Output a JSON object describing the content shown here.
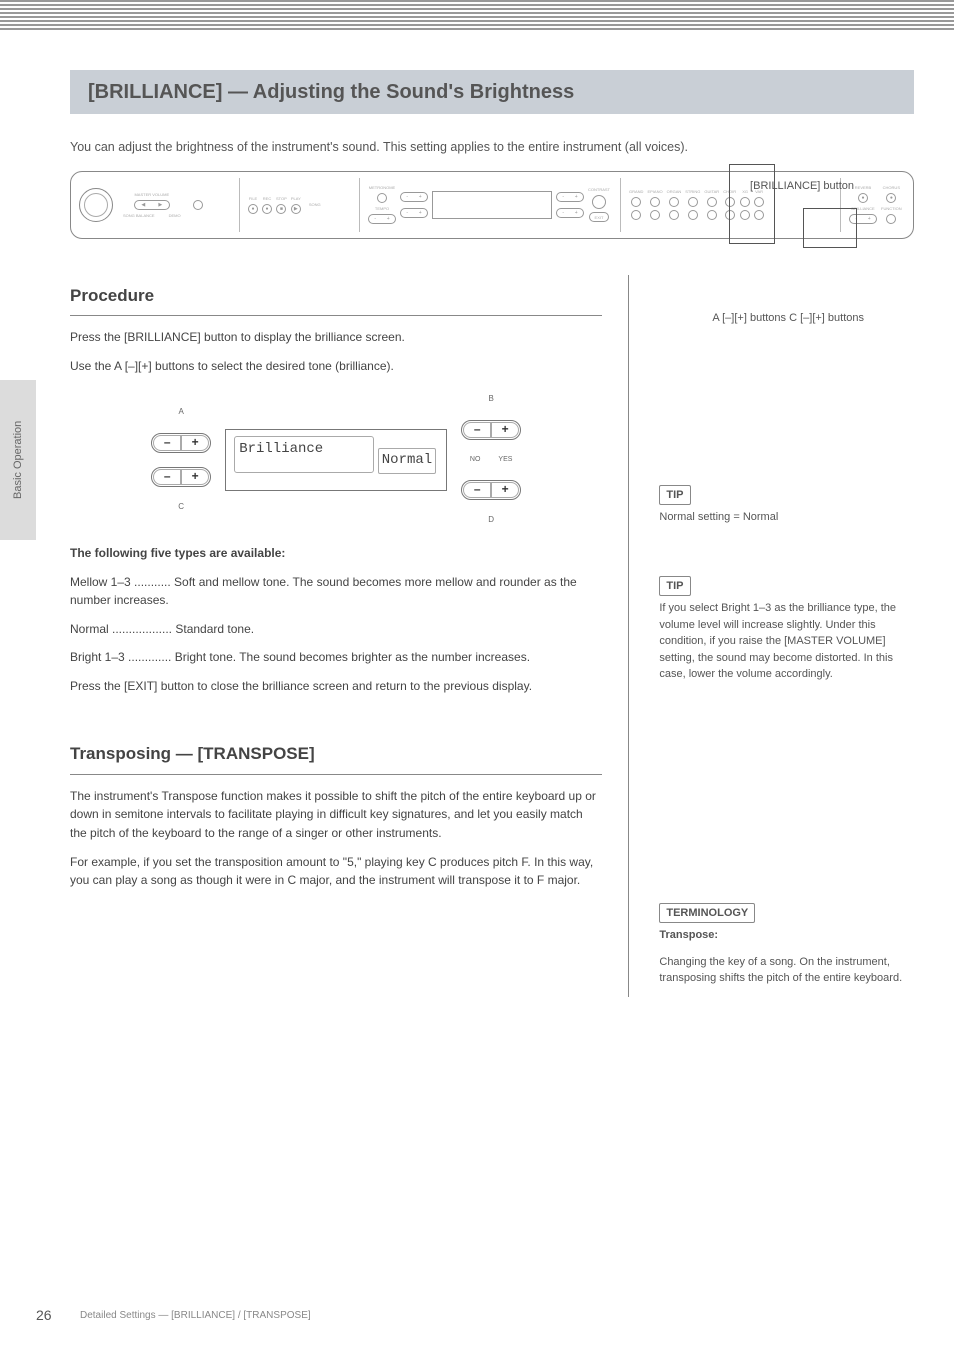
{
  "header": {
    "title": "[BRILLIANCE] — Adjusting the Sound's Brightness"
  },
  "intro": "You can adjust the brightness of the instrument's sound. This setting applies to the entire instrument (all voices).",
  "equipment_labels": {
    "left_label": "MASTER VOLUME",
    "left_sub1": "SONG BALANCE",
    "left_sub2": "DEMO",
    "song_title": "SONG",
    "metronome": "METRONOME",
    "tempo": "TEMPO",
    "contrast": "CONTRAST",
    "exit": "EXIT",
    "voice_title": "VOICE",
    "reverb": "REVERB",
    "chorus": "CHORUS",
    "func": "FUNCTION"
  },
  "callouts": {
    "buttons": "[BRILLIANCE] button",
    "abcd": "A [–][+] buttons   C [–][+] buttons"
  },
  "section1": {
    "h2": "Procedure",
    "p1": "Press the [BRILLIANCE] button to display the brilliance screen.",
    "p2": "Use the A [–][+] buttons to select the desired tone (brilliance).",
    "p3": "Press the [EXIT] button to close the brilliance screen and return to the previous display.",
    "lcd_label": "Brilliance",
    "lcd_value": "Normal",
    "btn_letters": {
      "a": "A",
      "b": "B",
      "c": "C",
      "d": "D"
    },
    "yn": {
      "no": "NO",
      "yes": "YES"
    },
    "options_title": "The following five types are available:",
    "opt1": "Mellow 1–3 ........... Soft and mellow tone. The sound becomes more mellow and rounder as the number increases.",
    "opt2": "Normal .................. Standard tone.",
    "opt3": "Bright 1–3 ............. Bright tone. The sound becomes brighter as the number increases."
  },
  "section2": {
    "h2": "Transposing — [TRANSPOSE]",
    "p1": "The instrument's Transpose function makes it possible to shift the pitch of the entire keyboard up or down in semitone intervals to facilitate playing in difficult key signatures, and let you easily match the pitch of the keyboard to the range of a singer or other instruments.",
    "p2": "For example, if you set the transposition amount to \"5,\" playing key C produces pitch F. In this way, you can play a song as though it were in C major, and the instrument will transpose it to F major."
  },
  "tip1": {
    "label": "TIP",
    "body": "Normal setting = Normal"
  },
  "tip2": {
    "label": "TIP",
    "body": "If you select Bright 1–3 as the brilliance type, the volume level will increase slightly. Under this condition, if you raise the [MASTER VOLUME] setting, the sound may become distorted. In this case, lower the volume accordingly."
  },
  "tip3": {
    "label": "TERMINOLOGY",
    "title": "Transpose:",
    "body": "Changing the key of a song. On the instrument, transposing shifts the pitch of the entire keyboard."
  },
  "side_tab": "Basic Operation",
  "page_number": "26",
  "footer_title": "Detailed Settings — [BRILLIANCE] / [TRANSPOSE]"
}
